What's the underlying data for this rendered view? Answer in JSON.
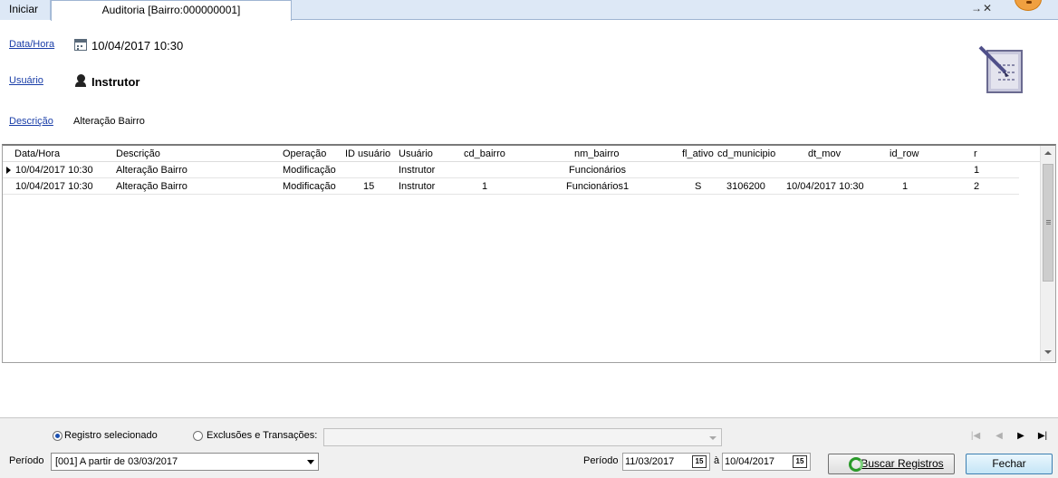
{
  "tabs": {
    "home_label": "Iniciar",
    "audit_label": "Auditoria [Bairro:000000001]",
    "controls": "→✕"
  },
  "header": {
    "datetime_label": "Data/Hora",
    "datetime_value": "10/04/2017 10:30",
    "user_label": "Usuário",
    "user_value": "Instrutor",
    "description_label": "Descrição",
    "description_value": "Alteração Bairro"
  },
  "grid": {
    "columns": [
      "Data/Hora",
      "Descrição",
      "Operação",
      "ID usuário",
      "Usuário",
      "cd_bairro",
      "nm_bairro",
      "fl_ativo",
      "cd_municipio",
      "dt_mov",
      "id_row",
      "r"
    ],
    "rows": [
      {
        "data_hora": "10/04/2017 10:30",
        "descricao": "Alteração Bairro",
        "operacao": "Modificação",
        "id_usuario": "",
        "usuario": "Instrutor",
        "cd_bairro": "",
        "nm_bairro": "Funcionários",
        "fl_ativo": "",
        "cd_municipio": "",
        "dt_mov": "",
        "id_row": "",
        "r": "1"
      },
      {
        "data_hora": "10/04/2017 10:30",
        "descricao": "Alteração Bairro",
        "operacao": "Modificação",
        "id_usuario": "15",
        "usuario": "Instrutor",
        "cd_bairro": "1",
        "nm_bairro": "Funcionários1",
        "fl_ativo": "S",
        "cd_municipio": "3106200",
        "dt_mov": "10/04/2017 10:30",
        "id_row": "1",
        "r": "2"
      }
    ]
  },
  "footer": {
    "radio_selected_label": "Registro selecionado",
    "radio_exclusions_label": "Exclusões e Transações:",
    "period_label": "Período",
    "period_select_value": "[001] A partir de 03/03/2017",
    "period_range_label": "Período",
    "date_from": "11/03/2017",
    "date_sep": "à",
    "date_to": "10/04/2017",
    "calendar_btn_label": "15",
    "search_button_label": "Buscar Registros",
    "close_button_label": "Fechar",
    "nav_first": "|◀",
    "nav_prev": "◀",
    "nav_next": "▶",
    "nav_last": "▶|"
  }
}
